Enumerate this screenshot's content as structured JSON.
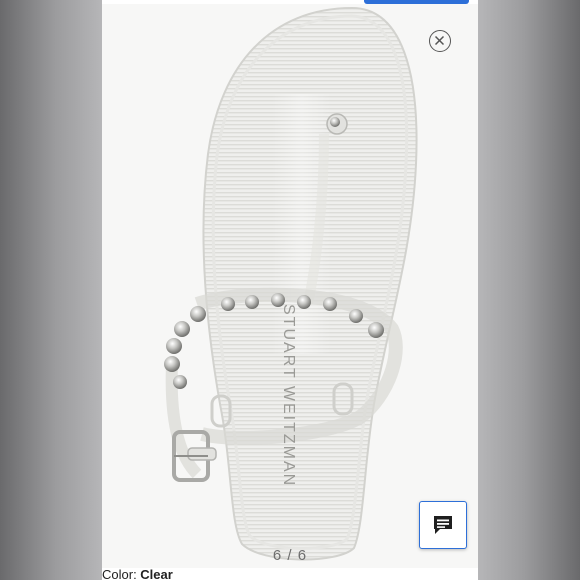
{
  "gallery": {
    "counter": "6 / 6",
    "image_alt": "Clear jelly thong sandal with silver studs and buckle strap",
    "close_icon": "close-circle-icon",
    "chat_icon": "chat-message-icon"
  },
  "product": {
    "color_label": "Color: ",
    "color_value": "Clear",
    "brand_imprint": "STUART WEITZMAN"
  },
  "colors": {
    "accent": "#2d6fd8",
    "frame": "#8b8b8d"
  }
}
